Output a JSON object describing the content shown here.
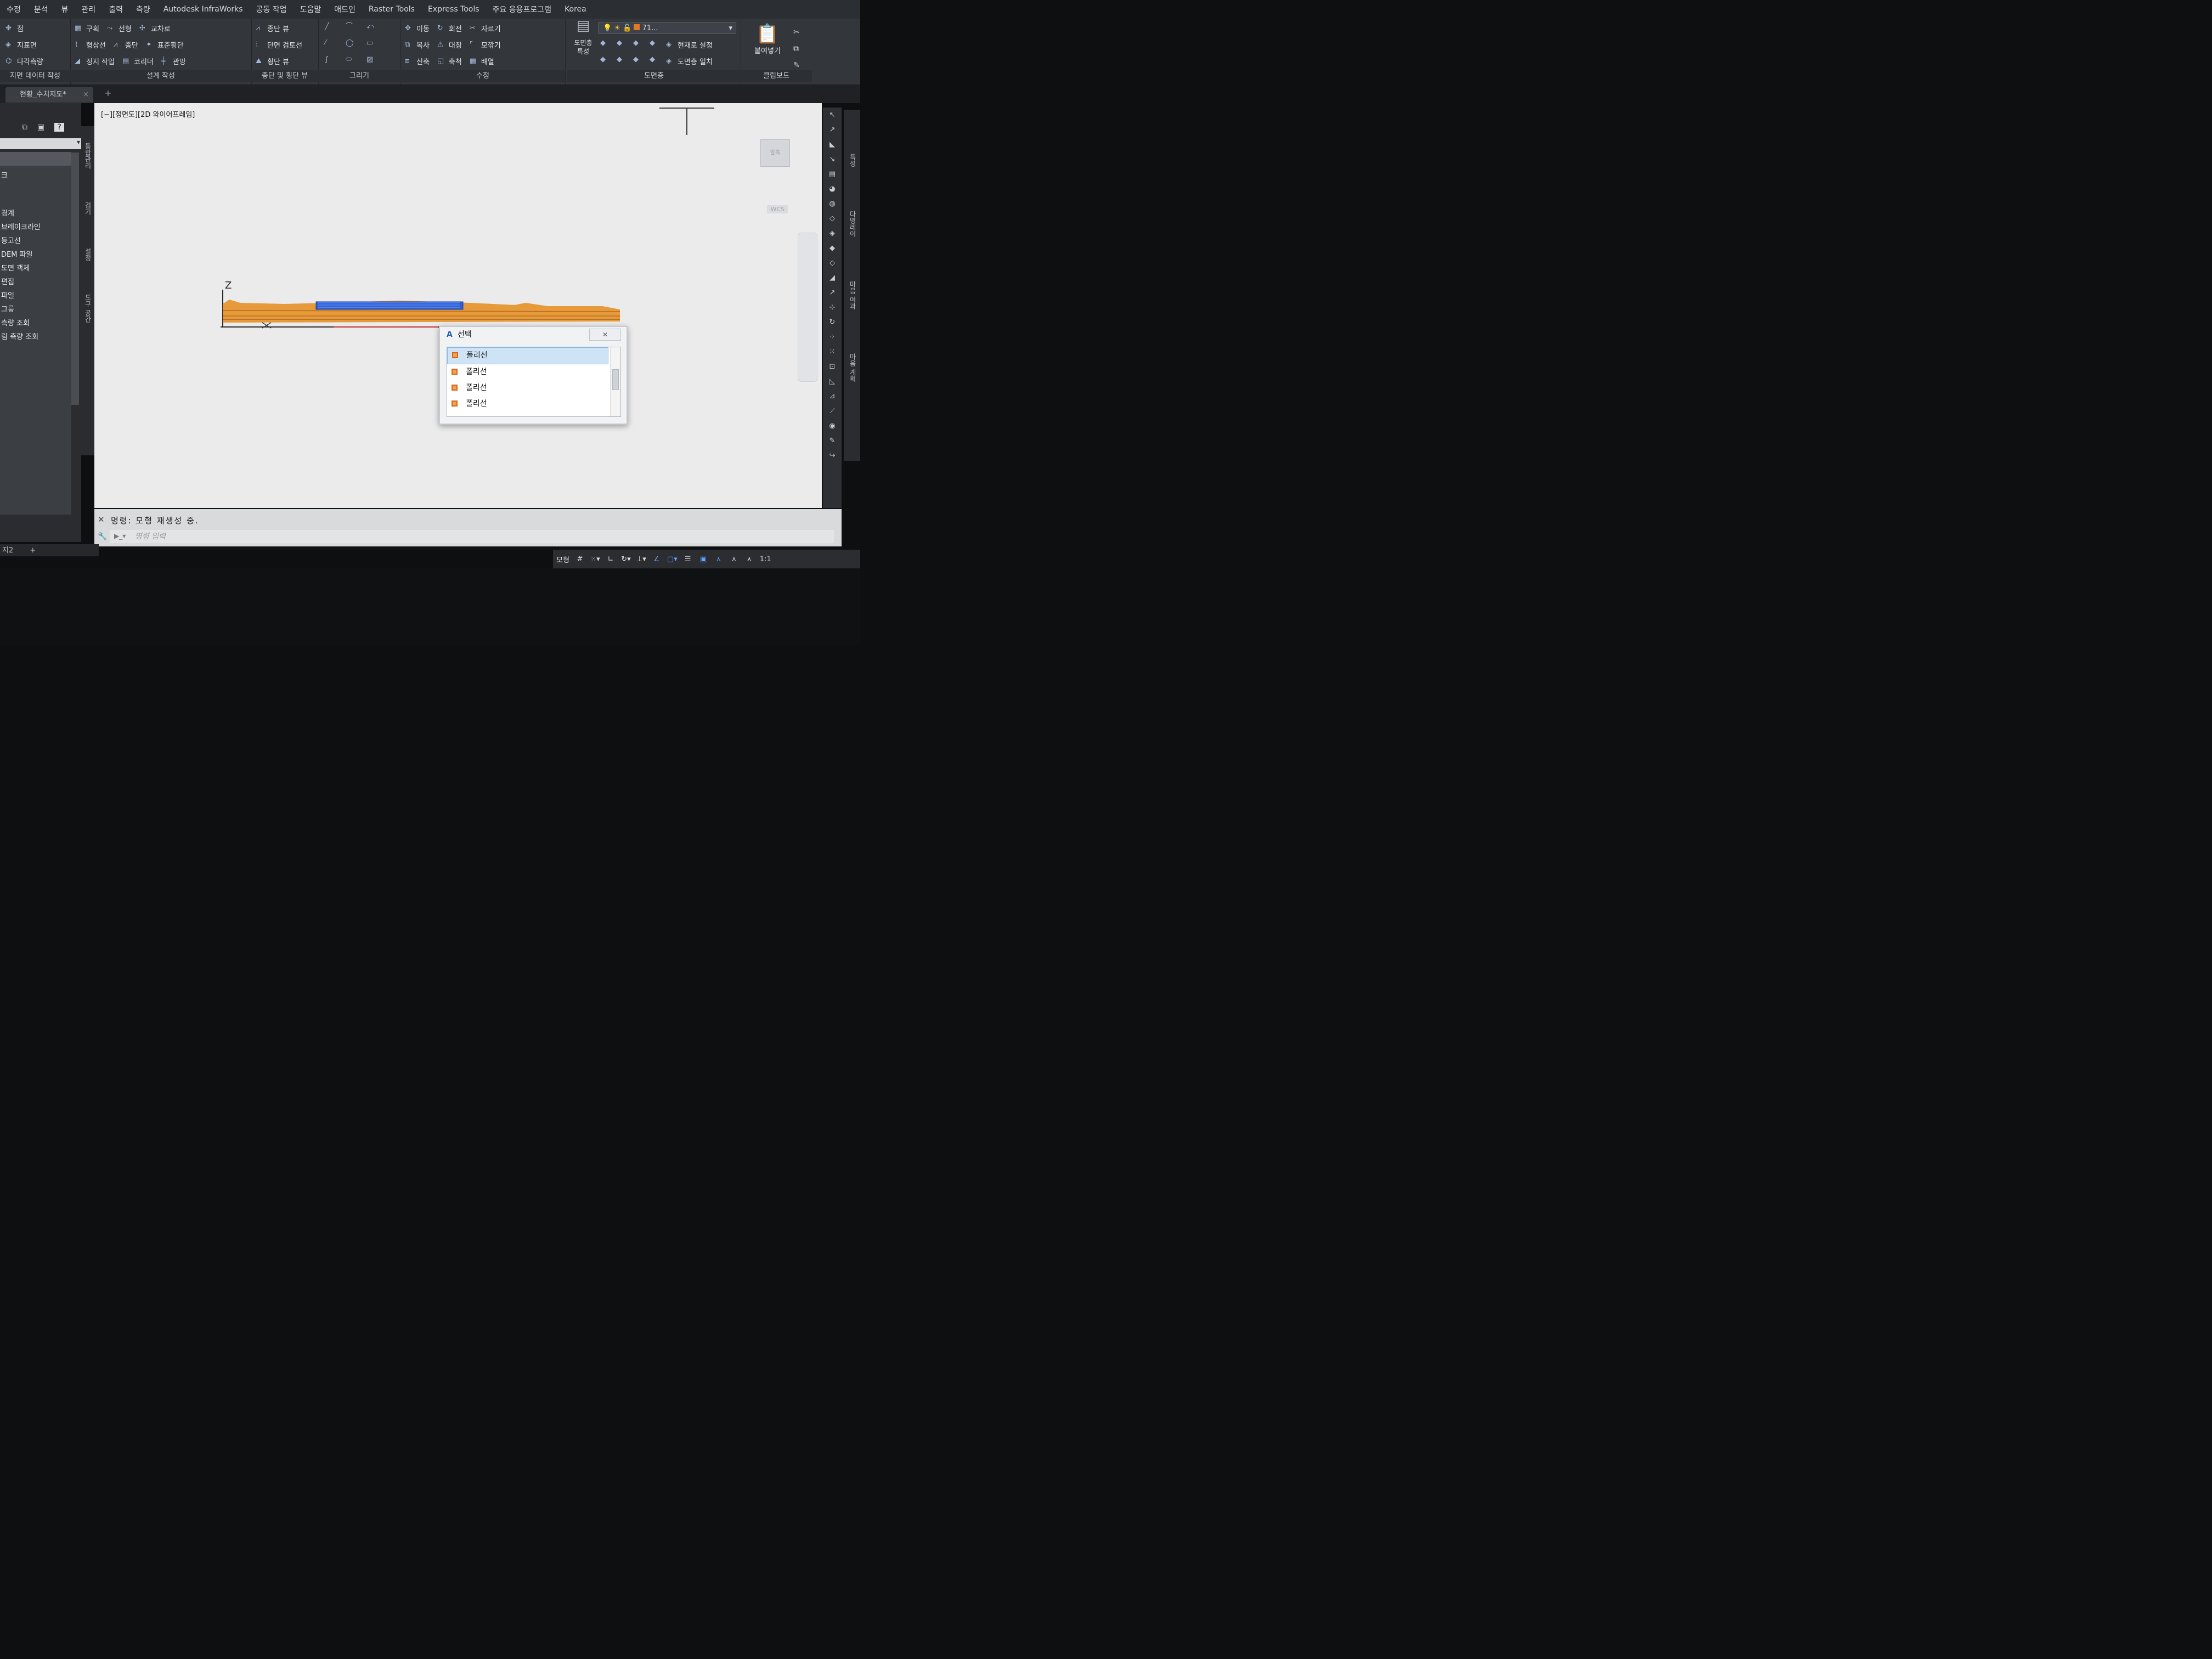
{
  "menubar": {
    "items": [
      "수정",
      "분석",
      "뷰",
      "관리",
      "출력",
      "측량",
      "Autodesk InfraWorks",
      "공동 작업",
      "도움말",
      "애드인",
      "Raster Tools",
      "Express Tools",
      "주요 응용프로그램",
      "Korea"
    ]
  },
  "ribbon": {
    "g1": {
      "r1": "점",
      "r2": "지표면",
      "r3": "다각측량",
      "label": "지면 데이터 작성"
    },
    "g2": {
      "a1": "구획",
      "a2": "형상선",
      "a3": "정지 작업",
      "b1": "선형",
      "b2": "종단",
      "b3": "코리더",
      "c1": "교차로",
      "c2": "표준횡단",
      "c3": "관망",
      "label": "설계 작성"
    },
    "g3": {
      "r1": "종단 뷰",
      "r2": "단면 검토선",
      "r3": "횡단 뷰",
      "label": "종단 및 횡단 뷰"
    },
    "g4": {
      "label": "그리기"
    },
    "g5": {
      "a1": "이동",
      "a2": "복사",
      "a3": "신축",
      "b1": "회전",
      "b2": "대칭",
      "b3": "축척",
      "c1": "자르기",
      "c2": "모깎기",
      "c3": "배열",
      "label": "수정"
    },
    "g6": {
      "big": "도면층 특성",
      "layer_value": "71...",
      "r2": "현재로 설정",
      "r3": "도면층 일치",
      "label": "도면층"
    },
    "g7": {
      "big": "붙여넣기",
      "label": "클립보드"
    }
  },
  "doc_tab": {
    "name": "현황_수치지도*"
  },
  "palette": {
    "items": [
      "크",
      "",
      "",
      "경계",
      "브레이크라인",
      "등고선",
      "DEM 파일",
      "도면 객체",
      "편집",
      "파일",
      "그룹",
      "측량 조회",
      "림 측량 조회"
    ],
    "strip_labels": [
      "통합관리",
      "검기",
      "설정",
      "도구 공간"
    ]
  },
  "viewport": {
    "label": "[−][정면도][2D 와이어프레임]",
    "viewcube": "앞쪽",
    "wcs": "WCS",
    "axis_z": "Z",
    "axis_x": "X"
  },
  "dialog": {
    "title": "선택",
    "items": [
      "폴리선",
      "폴리선",
      "폴리선",
      "폴리선"
    ]
  },
  "command": {
    "history": "명령: 모형 재생성 중.",
    "placeholder": "명령 입력"
  },
  "layout_tabs": {
    "tab": "지2",
    "add": "+"
  },
  "statusbar": {
    "model": "모형",
    "scale": "1:1"
  },
  "right_strip": [
    "특성",
    "다명레이",
    "마음 여과",
    "마음 계획"
  ]
}
